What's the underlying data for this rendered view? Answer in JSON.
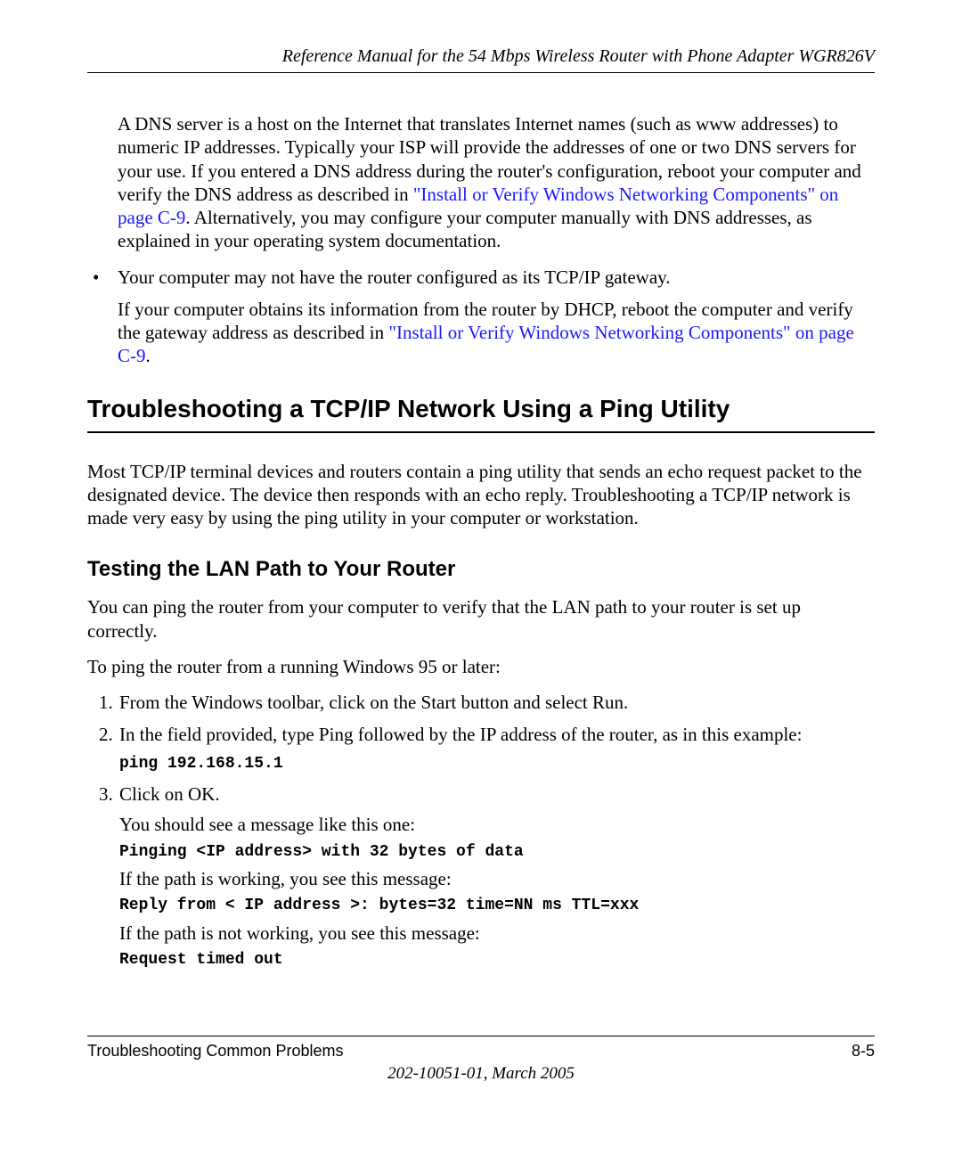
{
  "header": {
    "title": "Reference Manual for the 54 Mbps Wireless Router with Phone Adapter WGR826V"
  },
  "intro": {
    "para1_pre": "A DNS server is a host on the Internet that translates Internet names (such as www addresses) to numeric IP addresses. Typically your ISP will provide the addresses of one or two DNS servers for your use. If you entered a DNS address during the router's configuration, reboot your computer and verify the DNS address as described in ",
    "para1_link": "\"Install or Verify Windows Networking Components\" on page C-9",
    "para1_post": ". Alternatively, you may configure your computer manually with DNS addresses, as explained in your operating system documentation."
  },
  "bullet": {
    "line": "Your computer may not have the router configured as its TCP/IP gateway.",
    "para_pre": "If your computer obtains its information from the router by DHCP, reboot the computer and verify the gateway address as described in ",
    "para_link": "\"Install or Verify Windows Networking Components\" on page C-9",
    "para_post": "."
  },
  "h1": "Troubleshooting a TCP/IP Network Using a Ping Utility",
  "h1_para": "Most TCP/IP terminal devices and routers contain a ping utility that sends an echo request packet to the designated device. The device then responds with an echo reply. Troubleshooting a TCP/IP network is made very easy by using the ping utility in your computer or workstation.",
  "h2": "Testing the LAN Path to Your Router",
  "h2_para1": "You can ping the router from your computer to verify that the LAN path to your router is set up correctly.",
  "h2_para2": "To ping the router from a running Windows 95 or later:",
  "steps": {
    "s1": "From the Windows toolbar, click on the Start button and select Run.",
    "s2": "In the field provided, type Ping followed by the IP address of the router, as in this example:",
    "s2_code": "ping 192.168.15.1",
    "s3": "Click on OK.",
    "s3_p1": "You should see a message like this one:",
    "s3_code1": "Pinging <IP address> with 32 bytes of data",
    "s3_p2": "If the path is working, you see this message:",
    "s3_code2": "Reply from < IP address >: bytes=32 time=NN ms TTL=xxx",
    "s3_p3": "If the path is not working, you see this message:",
    "s3_code3": "Request timed out"
  },
  "footer": {
    "left": "Troubleshooting Common Problems",
    "right": "8-5",
    "date": "202-10051-01, March 2005"
  }
}
